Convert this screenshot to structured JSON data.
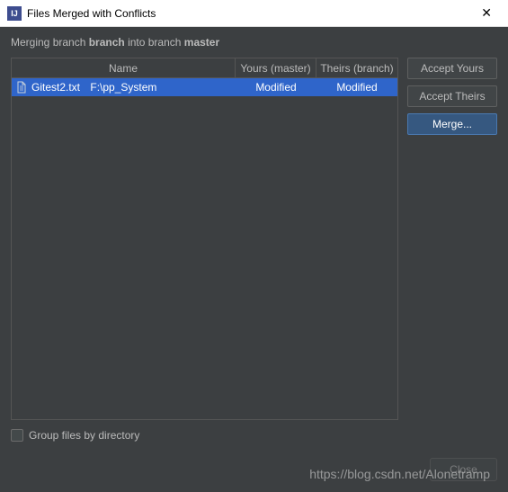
{
  "titlebar": {
    "title": "Files Merged with Conflicts"
  },
  "merge_desc": {
    "prefix": "Merging branch ",
    "source_branch": "branch",
    "middle": " into branch ",
    "target_branch": "master"
  },
  "table": {
    "headers": {
      "name": "Name",
      "yours": "Yours (master)",
      "theirs": "Theirs (branch)"
    },
    "rows": [
      {
        "filename": "Gitest2.txt",
        "path": "F:\\pp_System",
        "yours_status": "Modified",
        "theirs_status": "Modified"
      }
    ]
  },
  "buttons": {
    "accept_yours": "Accept Yours",
    "accept_theirs": "Accept Theirs",
    "merge": "Merge..."
  },
  "footer": {
    "group_by_dir": "Group files by directory",
    "close": "Close"
  },
  "watermark": "https://blog.csdn.net/Alonetramp"
}
